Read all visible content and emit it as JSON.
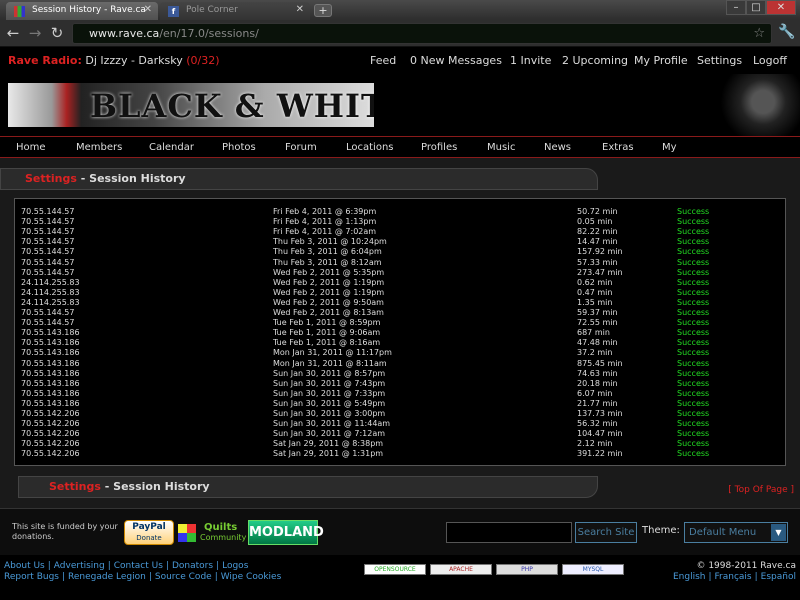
{
  "browser": {
    "tabs": [
      {
        "title": "Session History - Rave.ca",
        "active": true
      },
      {
        "title": "Pole Corner",
        "active": false
      }
    ],
    "url_host": "www.rave.ca",
    "url_path": "/en/17.0/sessions/"
  },
  "topbar": {
    "radio_label": "Rave Radio:",
    "radio_dj": "Dj Izzzy - Darksky",
    "radio_count": "(0/32)",
    "links": [
      "Feed",
      "0 New Messages",
      "1 Invite",
      "2 Upcoming",
      "My Profile",
      "Settings",
      "Logoff"
    ]
  },
  "banner": {
    "text": "BLACK & WHITE"
  },
  "nav": [
    "Home",
    "Members",
    "Calendar",
    "Photos",
    "Forum",
    "Locations",
    "Profiles",
    "Music",
    "News",
    "Extras",
    "My"
  ],
  "section": {
    "parent": "Settings",
    "separator": " - ",
    "title": "Session History"
  },
  "sessions": [
    {
      "ip": "70.55.144.57",
      "date": "Fri Feb 4, 2011 @ 6:39pm",
      "duration": "50.72 min",
      "status": "Success"
    },
    {
      "ip": "70.55.144.57",
      "date": "Fri Feb 4, 2011 @ 1:13pm",
      "duration": "0.05 min",
      "status": "Success"
    },
    {
      "ip": "70.55.144.57",
      "date": "Fri Feb 4, 2011 @ 7:02am",
      "duration": "82.22 min",
      "status": "Success"
    },
    {
      "ip": "70.55.144.57",
      "date": "Thu Feb 3, 2011 @ 10:24pm",
      "duration": "14.47 min",
      "status": "Success"
    },
    {
      "ip": "70.55.144.57",
      "date": "Thu Feb 3, 2011 @ 6:04pm",
      "duration": "157.92 min",
      "status": "Success"
    },
    {
      "ip": "70.55.144.57",
      "date": "Thu Feb 3, 2011 @ 8:12am",
      "duration": "57.33 min",
      "status": "Success"
    },
    {
      "ip": "70.55.144.57",
      "date": "Wed Feb 2, 2011 @ 5:35pm",
      "duration": "273.47 min",
      "status": "Success"
    },
    {
      "ip": "24.114.255.83",
      "date": "Wed Feb 2, 2011 @ 1:19pm",
      "duration": "0.62 min",
      "status": "Success"
    },
    {
      "ip": "24.114.255.83",
      "date": "Wed Feb 2, 2011 @ 1:19pm",
      "duration": "0.47 min",
      "status": "Success"
    },
    {
      "ip": "24.114.255.83",
      "date": "Wed Feb 2, 2011 @ 9:50am",
      "duration": "1.35 min",
      "status": "Success"
    },
    {
      "ip": "70.55.144.57",
      "date": "Wed Feb 2, 2011 @ 8:13am",
      "duration": "59.37 min",
      "status": "Success"
    },
    {
      "ip": "70.55.144.57",
      "date": "Tue Feb 1, 2011 @ 8:59pm",
      "duration": "72.55 min",
      "status": "Success"
    },
    {
      "ip": "70.55.143.186",
      "date": "Tue Feb 1, 2011 @ 9:06am",
      "duration": "687 min",
      "status": "Success"
    },
    {
      "ip": "70.55.143.186",
      "date": "Tue Feb 1, 2011 @ 8:16am",
      "duration": "47.48 min",
      "status": "Success"
    },
    {
      "ip": "70.55.143.186",
      "date": "Mon Jan 31, 2011 @ 11:17pm",
      "duration": "37.2 min",
      "status": "Success"
    },
    {
      "ip": "70.55.143.186",
      "date": "Mon Jan 31, 2011 @ 8:11am",
      "duration": "875.45 min",
      "status": "Success"
    },
    {
      "ip": "70.55.143.186",
      "date": "Sun Jan 30, 2011 @ 8:57pm",
      "duration": "74.63 min",
      "status": "Success"
    },
    {
      "ip": "70.55.143.186",
      "date": "Sun Jan 30, 2011 @ 7:43pm",
      "duration": "20.18 min",
      "status": "Success"
    },
    {
      "ip": "70.55.143.186",
      "date": "Sun Jan 30, 2011 @ 7:33pm",
      "duration": "6.07 min",
      "status": "Success"
    },
    {
      "ip": "70.55.143.186",
      "date": "Sun Jan 30, 2011 @ 5:49pm",
      "duration": "21.77 min",
      "status": "Success"
    },
    {
      "ip": "70.55.142.206",
      "date": "Sun Jan 30, 2011 @ 3:00pm",
      "duration": "137.73 min",
      "status": "Success"
    },
    {
      "ip": "70.55.142.206",
      "date": "Sun Jan 30, 2011 @ 11:44am",
      "duration": "56.32 min",
      "status": "Success"
    },
    {
      "ip": "70.55.142.206",
      "date": "Sun Jan 30, 2011 @ 7:12am",
      "duration": "104.47 min",
      "status": "Success"
    },
    {
      "ip": "70.55.142.206",
      "date": "Sat Jan 29, 2011 @ 8:38pm",
      "duration": "2.12 min",
      "status": "Success"
    },
    {
      "ip": "70.55.142.206",
      "date": "Sat Jan 29, 2011 @ 1:31pm",
      "duration": "391.22 min",
      "status": "Success"
    }
  ],
  "top_of_page": "[ Top Of Page ]",
  "funding": {
    "text": "This site is funded by your donations.",
    "paypal_line1": "PayPal",
    "paypal_line2": "Donate",
    "quilts_line1": "Quilts",
    "quilts_line2": "Community",
    "modland": "MODLAND",
    "search_button": "Search Site",
    "theme_label": "Theme:",
    "theme_value": "Default Menu"
  },
  "footer": {
    "links_row1": [
      "About Us",
      "Advertising",
      "Contact Us",
      "Donators",
      "Logos"
    ],
    "links_row2": [
      "Report Bugs",
      "Renegade Legion",
      "Source Code",
      "Wipe Cookies"
    ],
    "badges": [
      "OPENSOURCE",
      "APACHE",
      "PHP",
      "MYSQL"
    ],
    "copyright": "© 1998-2011 Rave.ca",
    "languages": [
      "English",
      "Français",
      "Español"
    ]
  },
  "colors": {
    "accent_red": "#dd2222",
    "success_green": "#22dd22",
    "link_blue": "#4a9ad8"
  }
}
